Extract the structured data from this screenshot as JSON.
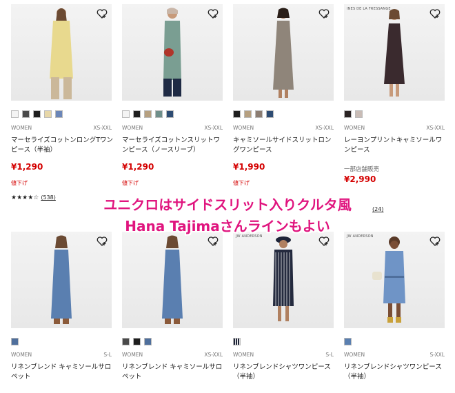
{
  "overlay": {
    "line1": "ユニクロはサイドスリット入りクルタ風",
    "line2": "Hana Tajimaさんラインもよい"
  },
  "products": [
    {
      "gender": "WOMEN",
      "size": "XS-XXL",
      "name": "マーセライズコットンロングTワンピース（半袖）",
      "price": "¥1,290",
      "sale": "値下げ",
      "stars": "★★★★☆",
      "reviews": "(538)",
      "swatches": [
        "#f4f4f4",
        "#4a4a4a",
        "#1e1e1e",
        "#e7d7a8",
        "#6b86b8"
      ],
      "dress": "#e8d98e"
    },
    {
      "gender": "WOMEN",
      "size": "XS-XXL",
      "name": "マーセライズコットンスリットワンピース（ノースリーブ）",
      "price": "¥1,290",
      "sale": "値下げ",
      "swatches": [
        "#f4f4f4",
        "#1e1e1e",
        "#b6a080",
        "#6f8f8a",
        "#2e4c73"
      ],
      "dress": "#7a9e92"
    },
    {
      "gender": "WOMEN",
      "size": "XS-XXL",
      "name": "キャミソールサイドスリットロングワンピース",
      "price": "¥1,990",
      "sale": "値下げ",
      "swatches": [
        "#1e1e1e",
        "#b6a080",
        "#8c7d72",
        "#2e4c73"
      ],
      "dress": "#8f857a"
    },
    {
      "gender": "WOMEN",
      "size": "XS-XXL",
      "name": "レーヨンプリントキャミソールワンピース",
      "store": "一部店舗販売",
      "price": "¥2,990",
      "reviews": "(24)",
      "swatches": [
        "#2b2424",
        "#c9bcb6"
      ],
      "dress": "#3a2a2e",
      "brand": "INES DE LA FRESSANGE"
    },
    {
      "gender": "WOMEN",
      "size": "S-L",
      "name": "リネンブレンド キャミソールサロペット",
      "swatches": [
        "#4f6f9c"
      ],
      "dress": "#5a7fb0"
    },
    {
      "gender": "WOMEN",
      "size": "XS-XXL",
      "name": "リネンブレンド キャミソールサロペット",
      "swatches": [
        "#4a4a4a",
        "#1e1e1e",
        "#4f6f9c"
      ],
      "dress": "#5a7fb0"
    },
    {
      "gender": "WOMEN",
      "size": "S-L",
      "name": "リネンブレンドシャツワンピース（半袖）",
      "swatches": [
        "#1e2438"
      ],
      "dress": "#242a3e",
      "brand": "JW ANDERSON"
    },
    {
      "gender": "WOMEN",
      "size": "S-XXL",
      "name": "リネンブレンドシャツワンピース（半袖）",
      "swatches": [
        "#5a7fb0"
      ],
      "dress": "#6f94c6",
      "brand": "JW ANDERSON"
    }
  ]
}
